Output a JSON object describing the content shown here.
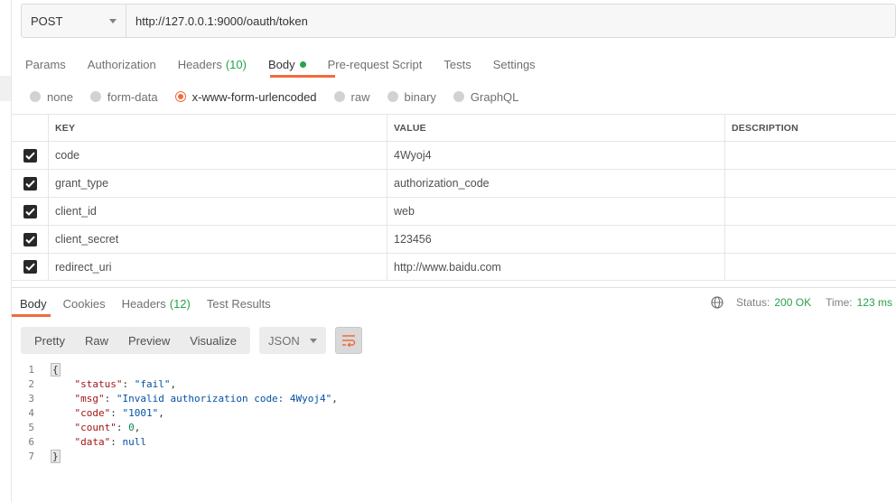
{
  "request": {
    "method": "POST",
    "url": "http://127.0.0.1:9000/oauth/token"
  },
  "request_tabs": [
    {
      "label": "Params"
    },
    {
      "label": "Authorization"
    },
    {
      "label": "Headers",
      "count": "(10)"
    },
    {
      "label": "Body",
      "active": true
    },
    {
      "label": "Pre-request Script"
    },
    {
      "label": "Tests"
    },
    {
      "label": "Settings"
    }
  ],
  "body_types": [
    {
      "label": "none"
    },
    {
      "label": "form-data"
    },
    {
      "label": "x-www-form-urlencoded",
      "selected": true
    },
    {
      "label": "raw"
    },
    {
      "label": "binary"
    },
    {
      "label": "GraphQL"
    }
  ],
  "table": {
    "headers": {
      "key": "KEY",
      "value": "VALUE",
      "description": "DESCRIPTION"
    },
    "rows": [
      {
        "key": "code",
        "value": "4Wyoj4",
        "description": "",
        "checked": true
      },
      {
        "key": "grant_type",
        "value": "authorization_code",
        "description": "",
        "checked": true
      },
      {
        "key": "client_id",
        "value": "web",
        "description": "",
        "checked": true
      },
      {
        "key": "client_secret",
        "value": "123456",
        "description": "",
        "checked": true
      },
      {
        "key": "redirect_uri",
        "value": "http://www.baidu.com",
        "description": "",
        "checked": true
      }
    ]
  },
  "response": {
    "tabs": {
      "body": "Body",
      "cookies": "Cookies",
      "headers": "Headers",
      "headers_count": "(12)",
      "test_results": "Test Results"
    },
    "status_label": "Status:",
    "status_value": "200 OK",
    "time_label": "Time:",
    "time_value": "123 ms",
    "view_modes": [
      "Pretty",
      "Raw",
      "Preview",
      "Visualize"
    ],
    "format": "JSON"
  },
  "code_lines": [
    {
      "num": "1",
      "tokens": [
        {
          "t": "{",
          "c": "brace"
        }
      ]
    },
    {
      "num": "2",
      "tokens": [
        {
          "t": "    ",
          "c": ""
        },
        {
          "t": "\"status\"",
          "c": "key"
        },
        {
          "t": ": ",
          "c": ""
        },
        {
          "t": "\"fail\"",
          "c": "str"
        },
        {
          "t": ",",
          "c": ""
        }
      ]
    },
    {
      "num": "3",
      "tokens": [
        {
          "t": "    ",
          "c": ""
        },
        {
          "t": "\"msg\"",
          "c": "key"
        },
        {
          "t": ": ",
          "c": ""
        },
        {
          "t": "\"Invalid authorization code: 4Wyoj4\"",
          "c": "str"
        },
        {
          "t": ",",
          "c": ""
        }
      ]
    },
    {
      "num": "4",
      "tokens": [
        {
          "t": "    ",
          "c": ""
        },
        {
          "t": "\"code\"",
          "c": "key"
        },
        {
          "t": ": ",
          "c": ""
        },
        {
          "t": "\"1001\"",
          "c": "str"
        },
        {
          "t": ",",
          "c": ""
        }
      ]
    },
    {
      "num": "5",
      "tokens": [
        {
          "t": "    ",
          "c": ""
        },
        {
          "t": "\"count\"",
          "c": "key"
        },
        {
          "t": ": ",
          "c": ""
        },
        {
          "t": "0",
          "c": "num"
        },
        {
          "t": ",",
          "c": ""
        }
      ]
    },
    {
      "num": "6",
      "tokens": [
        {
          "t": "    ",
          "c": ""
        },
        {
          "t": "\"data\"",
          "c": "key"
        },
        {
          "t": ": ",
          "c": ""
        },
        {
          "t": "null",
          "c": "nul"
        }
      ]
    },
    {
      "num": "7",
      "tokens": [
        {
          "t": "}",
          "c": "brace"
        }
      ]
    }
  ],
  "colors": {
    "accent": "#f26b3a",
    "success": "#26a34b"
  },
  "icons": {
    "method_dropdown": "chevron-down-icon",
    "checkbox": "checkmark-icon",
    "globe": "globe-icon",
    "wrap": "word-wrap-icon"
  }
}
